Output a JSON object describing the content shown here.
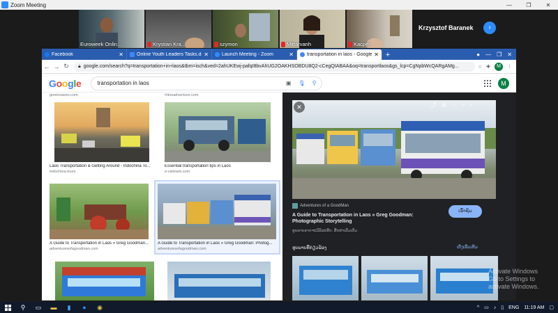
{
  "zoom": {
    "title": "Zoom Meeting",
    "participants": [
      {
        "name": "Euroweek Onlin...",
        "muted": false
      },
      {
        "name": "Krystian Kra...",
        "muted": true
      },
      {
        "name": "szymon",
        "muted": true
      },
      {
        "name": "Mittarvanh",
        "muted": true
      },
      {
        "name": "Kacper",
        "muted": true
      }
    ],
    "active_speaker": "Krzysztof Baranek"
  },
  "browser": {
    "tabs": [
      {
        "label": "Facebook",
        "active": false
      },
      {
        "label": "Online Youth Leaders Tasks.do",
        "active": false
      },
      {
        "label": "Launch Meeting - Zoom",
        "active": false
      },
      {
        "label": "transportation in laos - Google S",
        "active": true
      }
    ],
    "url": "google.com/search?q=transportation+in+laos&tbm=isch&ved=2ahUKEwj-pafqI8bvAhUG2OAKHSOBDU8Q2-cCegQIABAA&oq=transportlaos&gs_lcp=CgNpbWcQARgAMg...",
    "profile_initial": "M"
  },
  "google": {
    "logo": "Google",
    "query": "transportation in laos",
    "profile_initial": "M",
    "top_sources": [
      "greenvaveo.com",
      "rhinoadventure.com"
    ],
    "results": [
      {
        "caption": "Laos Transportation & Getting Around - Indochina To...",
        "source": "indochina.tours"
      },
      {
        "caption": "Essential transportation tips in Laos",
        "source": "e-vietnam.com"
      },
      {
        "caption": "A Guide to Transportation in Laos » Greg Goodman...",
        "source": "adventuresofagoodman.com"
      },
      {
        "caption": "A Guide to Transportation in Laos » Greg Goodman: Photog...",
        "source": "adventuresofagoodman.com"
      }
    ],
    "panel": {
      "source": "Adventures of a GoodMan",
      "title": "A Guide to Transportation in Laos » Greg Goodman: Photographic Storytelling",
      "visit_label": "ເຂົ້າຊົມ",
      "note": "ຮູບພາບອາດຈະມີລິຂະສິດ. ສຶກສາເພີ່ມເຕີມ",
      "related_label": "ຮູບພາບທີ່ກ່ຽວຂ້ອງ",
      "more_label": "ເບິ່ງເພີ່ມເຕີມ"
    }
  },
  "windows": {
    "watermark_line1": "Activate Windows",
    "watermark_line2": "Go to Settings to activate Windows.",
    "lang": "ENG",
    "time": "11:19 AM"
  },
  "colors": {
    "zoom_blue": "#2d8cff",
    "chrome_tab_bar": "#2a5db0",
    "panel_bg": "#202124",
    "link_blue": "#8ab4f8"
  }
}
